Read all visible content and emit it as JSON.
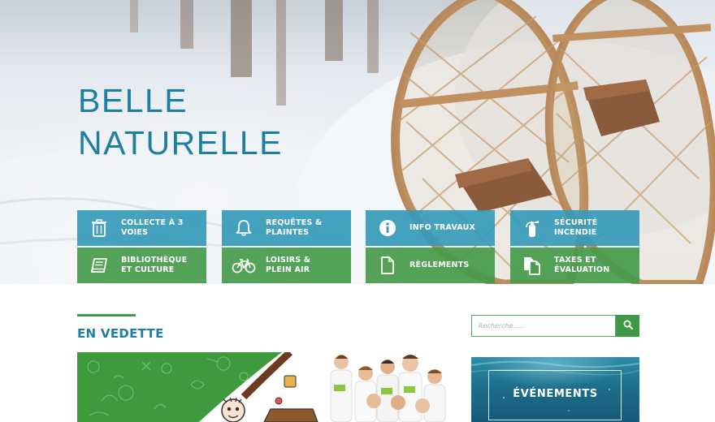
{
  "hero": {
    "title": "BELLE\nNATURELLE"
  },
  "tiles": [
    {
      "label": "COLLECTE À 3\nVOIES",
      "icon": "trash-can-icon",
      "color": "#369ab9"
    },
    {
      "label": "REQUÊTES &\nPLAINTES",
      "icon": "bell-icon",
      "color": "#369ab9"
    },
    {
      "label": "INFO TRAVAUX",
      "icon": "info-circle-icon",
      "color": "#369ab9"
    },
    {
      "label": "SÉCURITÉ\nINCENDIE",
      "icon": "fire-extinguisher-icon",
      "color": "#369ab9"
    },
    {
      "label": "BIBLIOTHÈQUE\nET CULTURE",
      "icon": "book-icon",
      "color": "#489c4c"
    },
    {
      "label": "LOISIRS &\nPLEIN AIR",
      "icon": "bicycle-icon",
      "color": "#489c4c"
    },
    {
      "label": "RÈGLEMENTS",
      "icon": "document-icon",
      "color": "#489c4c"
    },
    {
      "label": "TAXES ET\nÉVALUATION",
      "icon": "documents-icon",
      "color": "#489c4c"
    }
  ],
  "featured": {
    "title": "EN VEDETTE"
  },
  "search": {
    "placeholder": "Recherche......",
    "icon": "search-icon"
  },
  "events": {
    "label": "ÉVÉNEMENTS"
  },
  "colors": {
    "accent_blue": "#1f7fa3",
    "accent_green": "#3e9845"
  }
}
